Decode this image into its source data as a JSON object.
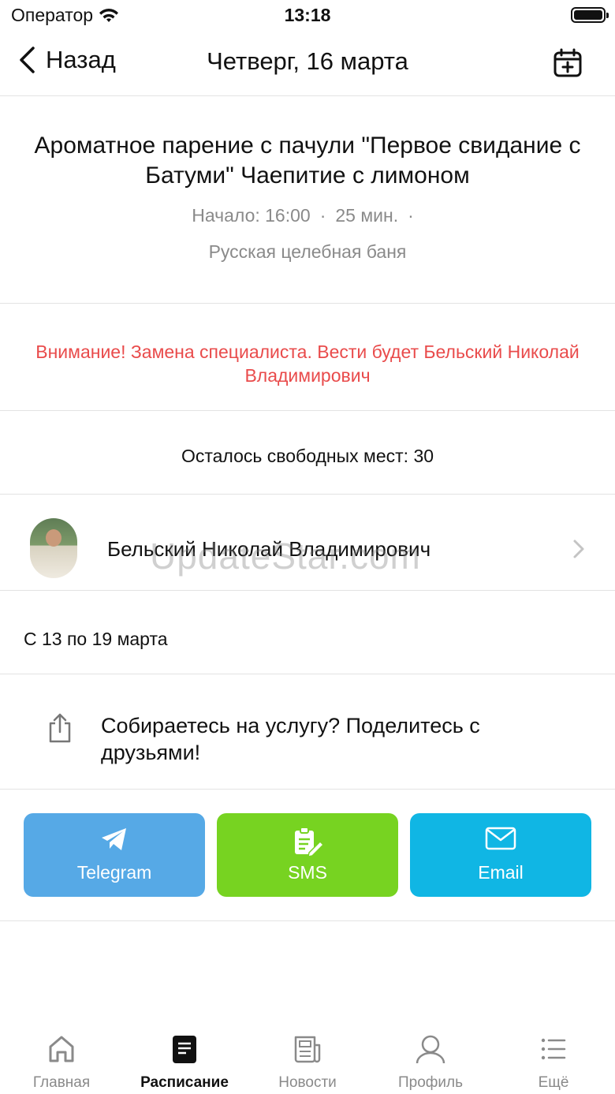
{
  "status_bar": {
    "carrier": "Оператор",
    "time": "13:18"
  },
  "nav": {
    "back_label": "Назад",
    "title": "Четверг, 16 марта"
  },
  "event": {
    "title": "Ароматное парение с пачули \"Первое свидание с Батуми\" Чаепитие с лимоном",
    "start": "Начало: 16:00",
    "duration": "25 мин.",
    "separator": "·",
    "place": "Русская целебная баня"
  },
  "warning": "Внимание! Замена специалиста. Вести будет Бельский Николай Владимирович",
  "seats": "Осталось свободных мест: 30",
  "specialist": {
    "name": "Бельский Николай Владимирович"
  },
  "watermark": "UpdateStar.com",
  "week": "С 13 по 19 марта",
  "share": {
    "prompt": "Собираетесь на услугу? Поделитесь с друзьями!",
    "buttons": [
      {
        "label": "Telegram",
        "color": "#56a9e6",
        "icon": "telegram-icon"
      },
      {
        "label": "SMS",
        "color": "#77d321",
        "icon": "sms-icon"
      },
      {
        "label": "Email",
        "color": "#10b6e4",
        "icon": "email-icon"
      }
    ]
  },
  "tabs": [
    {
      "label": "Главная",
      "icon": "home-icon",
      "active": false
    },
    {
      "label": "Расписание",
      "icon": "schedule-icon",
      "active": true
    },
    {
      "label": "Новости",
      "icon": "news-icon",
      "active": false
    },
    {
      "label": "Профиль",
      "icon": "profile-icon",
      "active": false
    },
    {
      "label": "Ещё",
      "icon": "more-icon",
      "active": false
    }
  ],
  "colors": {
    "warning": "#e94b4b",
    "muted": "#8a8a8a",
    "divider": "#e3e3e3"
  }
}
